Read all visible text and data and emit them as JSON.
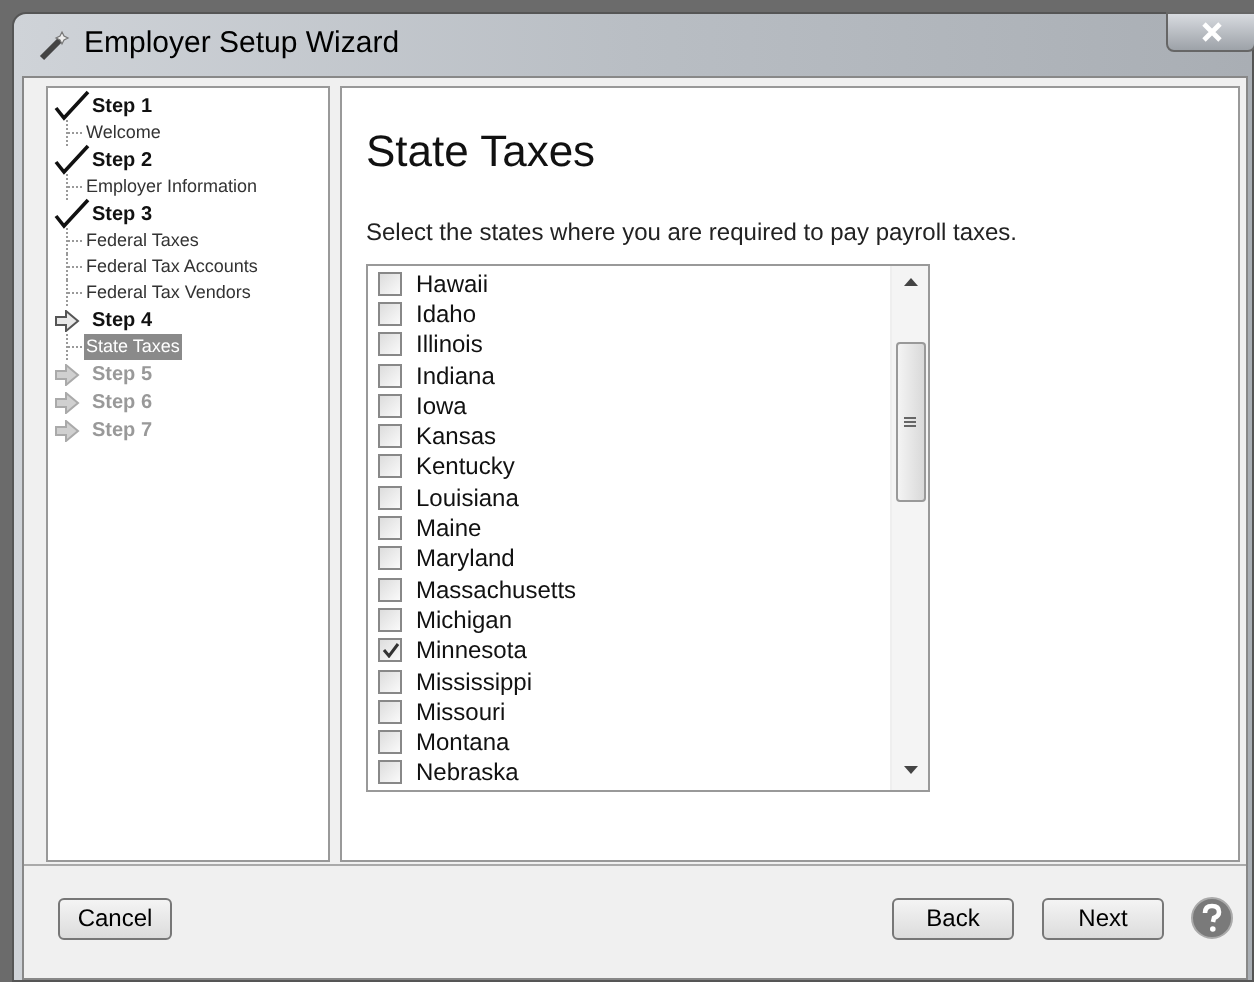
{
  "window": {
    "title": "Employer Setup Wizard"
  },
  "steps": [
    {
      "label": "Step 1",
      "kind": "done",
      "children": [
        {
          "label": "Welcome",
          "selected": false
        }
      ]
    },
    {
      "label": "Step 2",
      "kind": "done",
      "children": [
        {
          "label": "Employer Information",
          "selected": false
        }
      ]
    },
    {
      "label": "Step 3",
      "kind": "done",
      "children": [
        {
          "label": "Federal Taxes",
          "selected": false
        },
        {
          "label": "Federal Tax Accounts",
          "selected": false
        },
        {
          "label": "Federal Tax Vendors",
          "selected": false
        }
      ]
    },
    {
      "label": "Step 4",
      "kind": "current",
      "children": [
        {
          "label": "State Taxes",
          "selected": true
        }
      ]
    },
    {
      "label": "Step 5",
      "kind": "pending"
    },
    {
      "label": "Step 6",
      "kind": "pending"
    },
    {
      "label": "Step 7",
      "kind": "pending"
    }
  ],
  "page": {
    "title": "State Taxes",
    "instruction": "Select the states where you are required to pay payroll taxes."
  },
  "states": [
    {
      "label": "Hawaii",
      "checked": false
    },
    {
      "label": "Idaho",
      "checked": false
    },
    {
      "label": "Illinois",
      "checked": false
    },
    {
      "label": "Indiana",
      "checked": false
    },
    {
      "label": "Iowa",
      "checked": false
    },
    {
      "label": "Kansas",
      "checked": false
    },
    {
      "label": "Kentucky",
      "checked": false
    },
    {
      "label": "Louisiana",
      "checked": false
    },
    {
      "label": "Maine",
      "checked": false
    },
    {
      "label": "Maryland",
      "checked": false
    },
    {
      "label": "Massachusetts",
      "checked": false
    },
    {
      "label": "Michigan",
      "checked": false
    },
    {
      "label": "Minnesota",
      "checked": true
    },
    {
      "label": "Mississippi",
      "checked": false
    },
    {
      "label": "Missouri",
      "checked": false
    },
    {
      "label": "Montana",
      "checked": false
    },
    {
      "label": "Nebraska",
      "checked": false
    }
  ],
  "buttons": {
    "cancel": "Cancel",
    "back": "Back",
    "next": "Next"
  }
}
